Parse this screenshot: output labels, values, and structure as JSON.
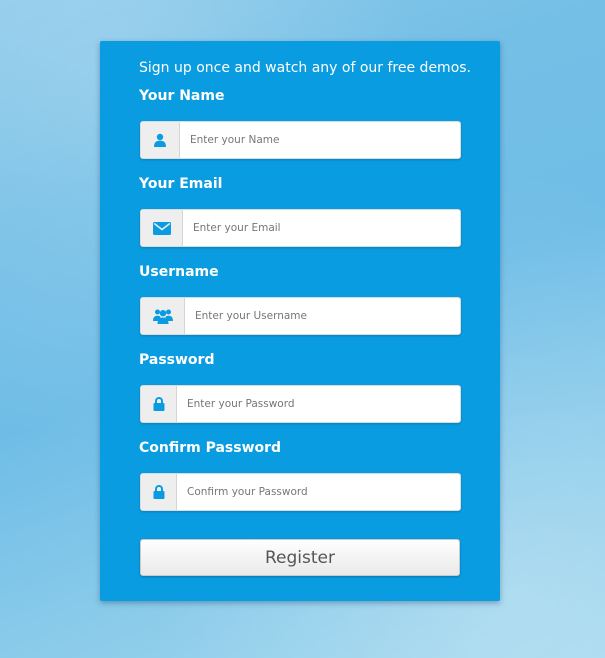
{
  "form": {
    "intro": "Sign up once and watch any of our free demos.",
    "fields": [
      {
        "label": "Your Name",
        "placeholder": "Enter your Name",
        "icon": "user-icon"
      },
      {
        "label": "Your Email",
        "placeholder": "Enter your Email",
        "icon": "envelope-icon"
      },
      {
        "label": "Username",
        "placeholder": "Enter your Username",
        "icon": "users-icon"
      },
      {
        "label": "Password",
        "placeholder": "Enter your Password",
        "icon": "lock-icon"
      },
      {
        "label": "Confirm Password",
        "placeholder": "Confirm your Password",
        "icon": "lock-icon"
      }
    ],
    "register_label": "Register"
  },
  "colors": {
    "panel": "#0a9ce0",
    "icon": "#0a9ce0",
    "background": "#74bfe6"
  }
}
